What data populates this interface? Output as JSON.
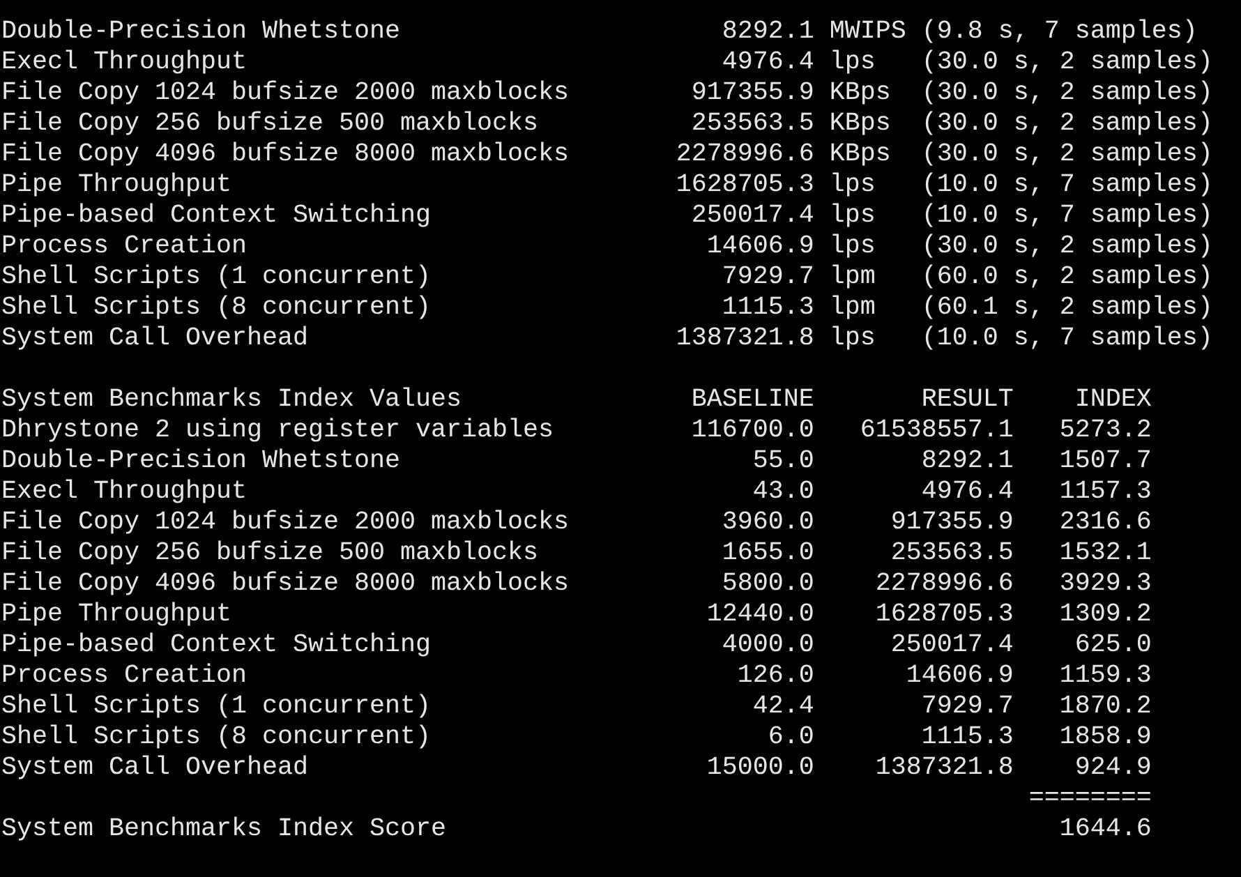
{
  "runs": [
    {
      "name": "Double-Precision Whetstone",
      "value": "8292.1",
      "unit": "MWIPS",
      "detail": "(9.8 s, 7 samples)"
    },
    {
      "name": "Execl Throughput",
      "value": "4976.4",
      "unit": "lps",
      "detail": "(30.0 s, 2 samples)"
    },
    {
      "name": "File Copy 1024 bufsize 2000 maxblocks",
      "value": "917355.9",
      "unit": "KBps",
      "detail": "(30.0 s, 2 samples)"
    },
    {
      "name": "File Copy 256 bufsize 500 maxblocks",
      "value": "253563.5",
      "unit": "KBps",
      "detail": "(30.0 s, 2 samples)"
    },
    {
      "name": "File Copy 4096 bufsize 8000 maxblocks",
      "value": "2278996.6",
      "unit": "KBps",
      "detail": "(30.0 s, 2 samples)"
    },
    {
      "name": "Pipe Throughput",
      "value": "1628705.3",
      "unit": "lps",
      "detail": "(10.0 s, 7 samples)"
    },
    {
      "name": "Pipe-based Context Switching",
      "value": "250017.4",
      "unit": "lps",
      "detail": "(10.0 s, 7 samples)"
    },
    {
      "name": "Process Creation",
      "value": "14606.9",
      "unit": "lps",
      "detail": "(30.0 s, 2 samples)"
    },
    {
      "name": "Shell Scripts (1 concurrent)",
      "value": "7929.7",
      "unit": "lpm",
      "detail": "(60.0 s, 2 samples)"
    },
    {
      "name": "Shell Scripts (8 concurrent)",
      "value": "1115.3",
      "unit": "lpm",
      "detail": "(60.1 s, 2 samples)"
    },
    {
      "name": "System Call Overhead",
      "value": "1387321.8",
      "unit": "lps",
      "detail": "(10.0 s, 7 samples)"
    }
  ],
  "index": {
    "title": "System Benchmarks Index Values",
    "columns": [
      "BASELINE",
      "RESULT",
      "INDEX"
    ],
    "rows": [
      {
        "name": "Dhrystone 2 using register variables",
        "baseline": "116700.0",
        "result": "61538557.1",
        "index": "5273.2"
      },
      {
        "name": "Double-Precision Whetstone",
        "baseline": "55.0",
        "result": "8292.1",
        "index": "1507.7"
      },
      {
        "name": "Execl Throughput",
        "baseline": "43.0",
        "result": "4976.4",
        "index": "1157.3"
      },
      {
        "name": "File Copy 1024 bufsize 2000 maxblocks",
        "baseline": "3960.0",
        "result": "917355.9",
        "index": "2316.6"
      },
      {
        "name": "File Copy 256 bufsize 500 maxblocks",
        "baseline": "1655.0",
        "result": "253563.5",
        "index": "1532.1"
      },
      {
        "name": "File Copy 4096 bufsize 8000 maxblocks",
        "baseline": "5800.0",
        "result": "2278996.6",
        "index": "3929.3"
      },
      {
        "name": "Pipe Throughput",
        "baseline": "12440.0",
        "result": "1628705.3",
        "index": "1309.2"
      },
      {
        "name": "Pipe-based Context Switching",
        "baseline": "4000.0",
        "result": "250017.4",
        "index": "625.0"
      },
      {
        "name": "Process Creation",
        "baseline": "126.0",
        "result": "14606.9",
        "index": "1159.3"
      },
      {
        "name": "Shell Scripts (1 concurrent)",
        "baseline": "42.4",
        "result": "7929.7",
        "index": "1870.2"
      },
      {
        "name": "Shell Scripts (8 concurrent)",
        "baseline": "6.0",
        "result": "1115.3",
        "index": "1858.9"
      },
      {
        "name": "System Call Overhead",
        "baseline": "15000.0",
        "result": "1387321.8",
        "index": "924.9"
      }
    ],
    "separator": "========",
    "score": {
      "label": "System Benchmarks Index Score",
      "value": "1644.6"
    }
  }
}
